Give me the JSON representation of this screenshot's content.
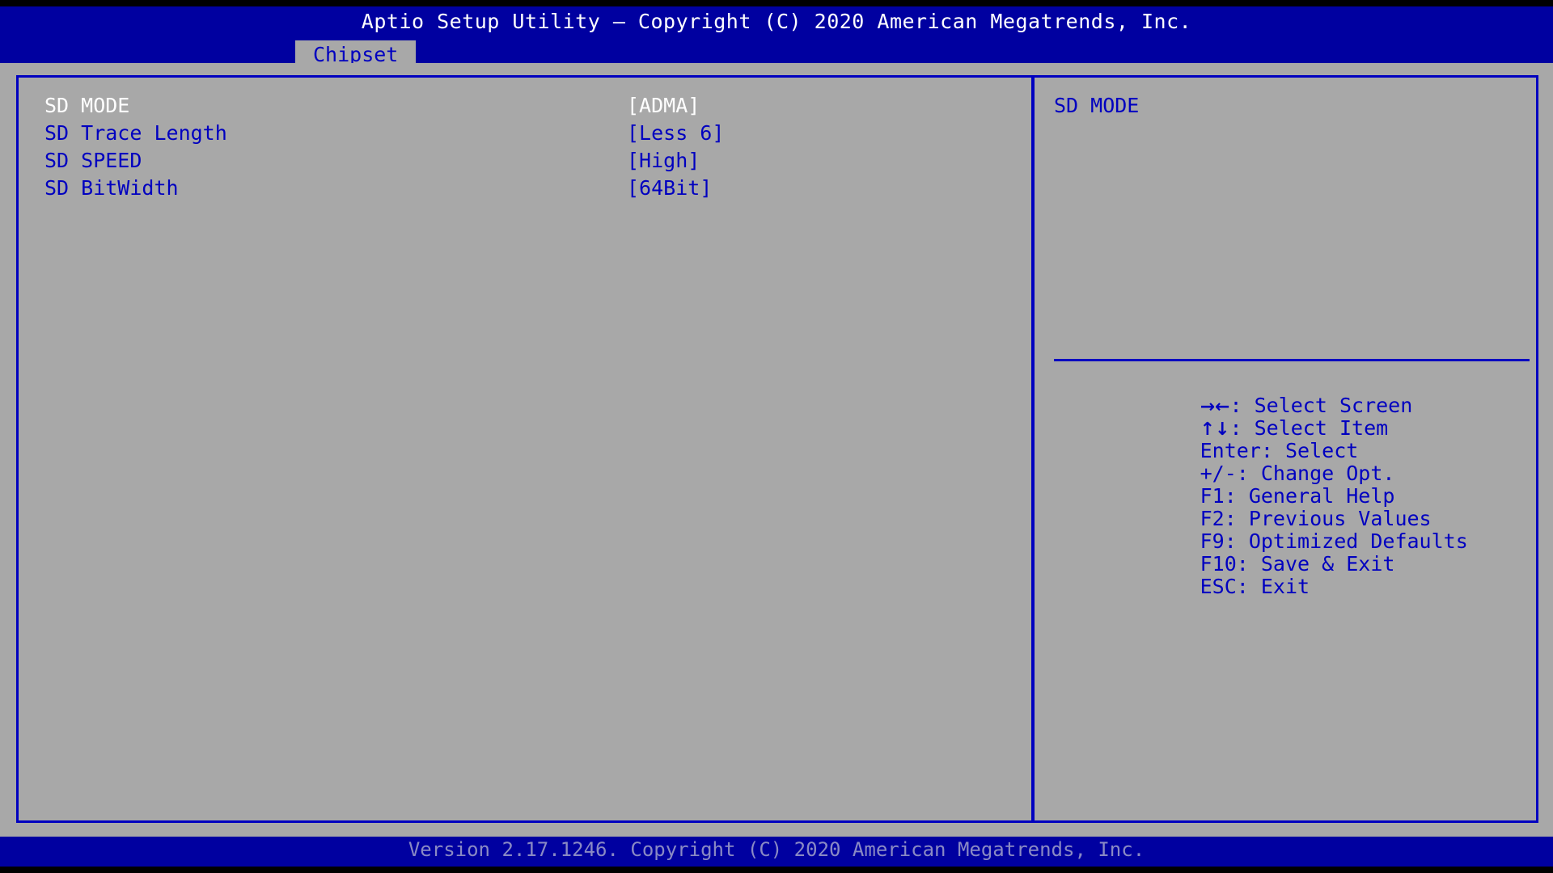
{
  "header": {
    "title": "Aptio Setup Utility – Copyright (C) 2020 American Megatrends, Inc.",
    "tabs": [
      {
        "label": "Chipset",
        "active": true
      }
    ]
  },
  "settings": {
    "rows": [
      {
        "label": "SD MODE",
        "value": "[ADMA]",
        "selected": true
      },
      {
        "label": "SD Trace Length",
        "value": "[Less 6]",
        "selected": false
      },
      {
        "label": "SD SPEED",
        "value": "[High]",
        "selected": false
      },
      {
        "label": "SD BitWidth",
        "value": "[64Bit]",
        "selected": false
      }
    ]
  },
  "help": {
    "description": "SD MODE",
    "legend": [
      {
        "keys": "→←",
        "text": ": Select Screen"
      },
      {
        "keys": "↑↓",
        "text": ": Select Item"
      },
      {
        "keys": "",
        "text": "Enter: Select"
      },
      {
        "keys": "",
        "text": "+/-: Change Opt."
      },
      {
        "keys": "",
        "text": "F1: General Help"
      },
      {
        "keys": "",
        "text": "F2: Previous Values"
      },
      {
        "keys": "",
        "text": "F9: Optimized Defaults"
      },
      {
        "keys": "",
        "text": "F10: Save & Exit"
      },
      {
        "keys": "",
        "text": "ESC: Exit"
      }
    ]
  },
  "footer": {
    "version": "Version 2.17.1246. Copyright (C) 2020 American Megatrends, Inc."
  },
  "colors": {
    "header_blue": "#0000a0",
    "body_grey": "#a8a8a8",
    "text_blue": "#0000c0",
    "text_selected": "#ffffff",
    "footer_text": "#8a8ac4",
    "black": "#000000"
  }
}
